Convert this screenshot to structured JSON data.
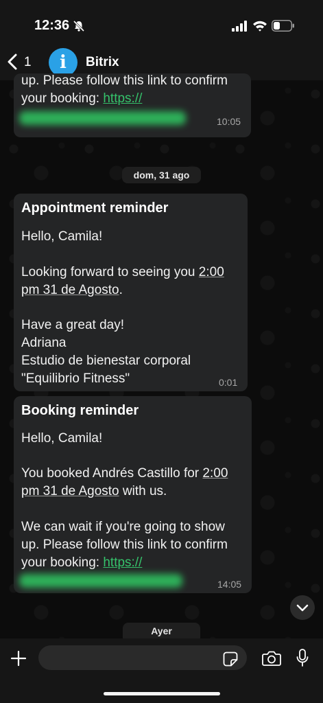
{
  "status_bar": {
    "time": "12:36"
  },
  "header": {
    "back_count": "1",
    "avatar_letter": "i",
    "contact_name": "Bitrix"
  },
  "messages": [
    {
      "lines": [
        "up. Please follow this link to confirm",
        "your booking: "
      ],
      "link": "https://",
      "time": "10:05"
    },
    {
      "title": "Appointment reminder",
      "greeting": "Hello, Camila!",
      "l1a": "Looking forward to seeing you ",
      "l1b": "2:00",
      "l2a": "pm 31 de Agosto",
      "l2b": ".",
      "l3": "Have a great day!",
      "l4": "Adriana",
      "l5": "Estudio de bienestar corporal",
      "l6": "\"Equilibrio Fitness\"",
      "time": "0:01"
    },
    {
      "title": "Booking reminder",
      "greeting": "Hello, Camila!",
      "l1a": "You booked Andrés Castillo for ",
      "l1b": "2:00",
      "l2a": "pm 31 de Agosto",
      "l2b": " with us.",
      "l3": "We can wait if you're going to show",
      "l4": "up. Please follow this link to confirm",
      "l5": "your booking: ",
      "link": "https://",
      "time": "14:05"
    }
  ],
  "date_separators": {
    "first": "dom, 31 ago",
    "second": "Ayer"
  },
  "colors": {
    "bubble": "#242526",
    "link": "#35c26b",
    "accent": "#2aa1e6"
  }
}
